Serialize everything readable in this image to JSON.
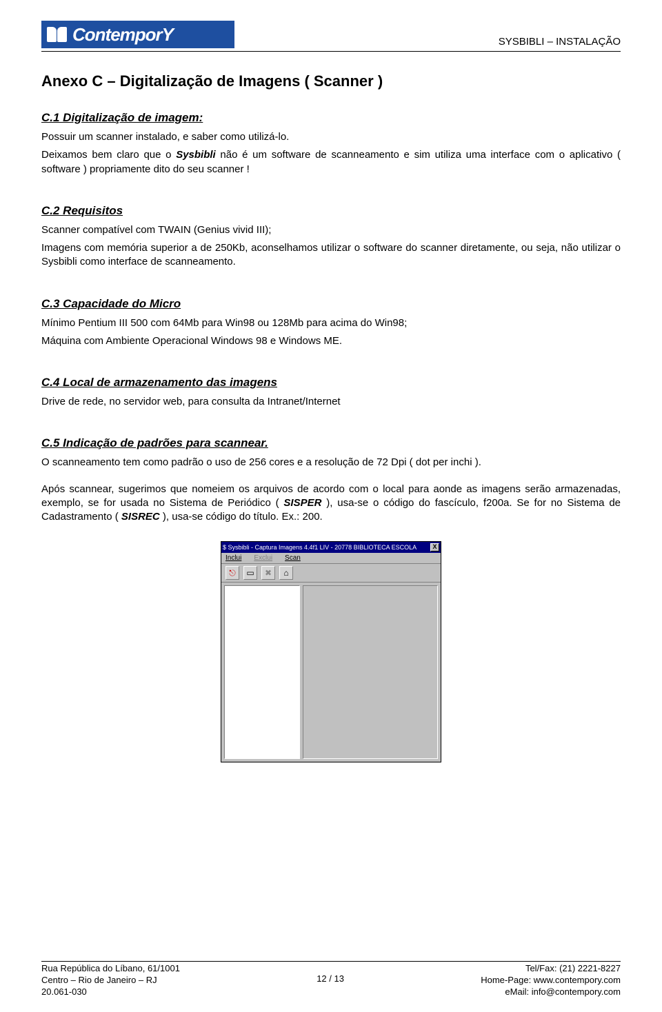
{
  "header": {
    "logo_text": "ContemporY",
    "right": "SYSBIBLI – INSTALAÇÃO"
  },
  "title": "Anexo C – Digitalização de Imagens ( Scanner )",
  "sections": {
    "c1": {
      "heading": "C.1 Digitalização de imagem:",
      "p1": "Possuir um scanner instalado, e saber como utilizá-lo.",
      "p2a": "Deixamos bem claro que o ",
      "p2b": "Sysbibli",
      "p2c": " não é um software de scanneamento e sim utiliza uma interface com o aplicativo ( software ) propriamente dito do seu scanner !"
    },
    "c2": {
      "heading": "C.2 Requisitos",
      "p1": "Scanner compatível com TWAIN (Genius vivid III);",
      "p2": "Imagens com memória superior a de 250Kb, aconselhamos utilizar o software do scanner diretamente, ou seja, não utilizar o Sysbibli como interface de scanneamento."
    },
    "c3": {
      "heading": "C.3 Capacidade do Micro",
      "p1": "Mínimo Pentium III 500 com 64Mb para Win98 ou 128Mb para acima do Win98;",
      "p2": "Máquina com Ambiente Operacional Windows 98 e Windows ME."
    },
    "c4": {
      "heading": "C.4 Local de armazenamento das imagens ",
      "p1": "Drive de rede, no servidor web, para consulta da Intranet/Internet"
    },
    "c5": {
      "heading": "C.5 Indicação de padrões para scannear.",
      "p1": "O scanneamento tem como padrão o uso de 256 cores e a resolução de 72 Dpi ( dot per inchi ).",
      "p2a": "Após scannear, sugerimos que nomeiem os arquivos de acordo com o local para aonde as imagens serão armazenadas, exemplo, se for usada no Sistema de Periódico ( ",
      "p2b": "SISPER",
      "p2c": " ), usa-se o código do fascículo, f200a. Se for no Sistema de Cadastramento ( ",
      "p2d": "SISREC",
      "p2e": " ), usa-se código do título. Ex.: 200."
    }
  },
  "window": {
    "title": "$ Sysbibli - Captura Imagens 4.4f1  LIV - 20778  BIBLIOTECA ESCOLA",
    "menu": {
      "inclui": "Inclui",
      "exclui": "Exclui",
      "scan": "Scan"
    },
    "close": "X"
  },
  "footer": {
    "left1": "Rua República do Líbano, 61/1001",
    "left2": "Centro – Rio de Janeiro – RJ",
    "left3": "20.061-030",
    "center": "12 / 13",
    "right1": "Tel/Fax: (21) 2221-8227",
    "right2": "Home-Page: www.contempory.com",
    "right3": "eMail: info@contempory.com"
  }
}
